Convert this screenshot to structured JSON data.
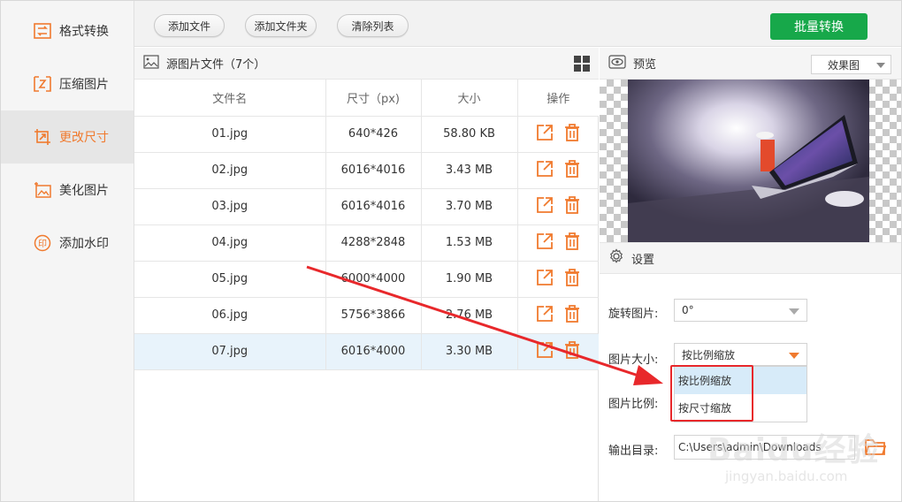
{
  "sidebar": {
    "items": [
      {
        "label": "格式转换",
        "icon": "format-convert-icon"
      },
      {
        "label": "压缩图片",
        "icon": "compress-icon"
      },
      {
        "label": "更改尺寸",
        "icon": "resize-icon",
        "active": true
      },
      {
        "label": "美化图片",
        "icon": "beautify-icon"
      },
      {
        "label": "添加水印",
        "icon": "watermark-icon"
      }
    ]
  },
  "toolbar": {
    "add_file": "添加文件",
    "add_folder": "添加文件夹",
    "clear_list": "清除列表",
    "batch_convert": "批量转换"
  },
  "filelist": {
    "title": "源图片文件（7个）",
    "columns": [
      "文件名",
      "尺寸（px)",
      "大小",
      "操作"
    ],
    "rows": [
      {
        "name": "01.jpg",
        "dims": "640*426",
        "size": "58.80 KB"
      },
      {
        "name": "02.jpg",
        "dims": "6016*4016",
        "size": "3.43 MB"
      },
      {
        "name": "03.jpg",
        "dims": "6016*4016",
        "size": "3.70 MB"
      },
      {
        "name": "04.jpg",
        "dims": "4288*2848",
        "size": "1.53 MB"
      },
      {
        "name": "05.jpg",
        "dims": "6000*4000",
        "size": "1.90 MB"
      },
      {
        "name": "06.jpg",
        "dims": "5756*3866",
        "size": "2.76 MB"
      },
      {
        "name": "07.jpg",
        "dims": "6016*4000",
        "size": "3.30 MB",
        "selected": true
      }
    ]
  },
  "preview": {
    "title": "预览",
    "mode": "效果图"
  },
  "settings": {
    "title": "设置",
    "rotate_label": "旋转图片:",
    "rotate_value": "0°",
    "size_label": "图片大小:",
    "size_value": "按比例缩放",
    "size_options": [
      "按比例缩放",
      "按尺寸缩放"
    ],
    "ratio_label": "图片比例:",
    "output_label": "输出目录:",
    "output_path": "C:\\Users\\admin\\Downloads"
  },
  "watermark": {
    "brand": "Baidu经验",
    "url": "jingyan.baidu.com"
  },
  "colors": {
    "accent": "#f07a2e",
    "primary_button": "#17a84a",
    "annotation": "#e8282b",
    "selected_row": "#e8f3fb"
  }
}
